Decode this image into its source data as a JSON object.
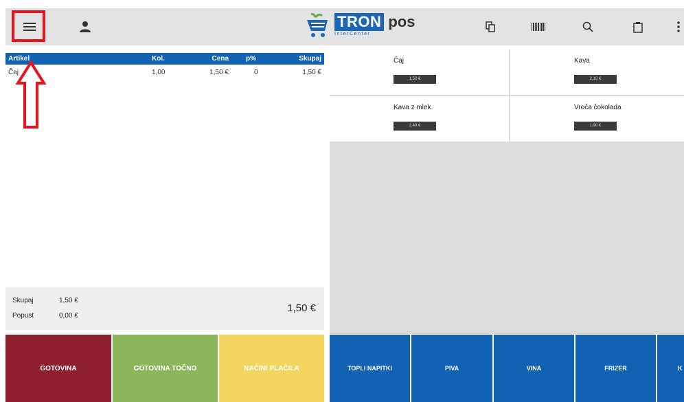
{
  "header": {
    "logo_brand": "TRON",
    "logo_sub": "InterCenter",
    "logo_suffix": "pos",
    "icons": [
      "menu-icon",
      "user-icon",
      "copy-icon",
      "barcode-icon",
      "search-icon",
      "clipboard-icon",
      "more-vert-icon"
    ]
  },
  "order": {
    "columns": {
      "item": "Artikel",
      "qty": "Kol.",
      "price": "Cena",
      "discount": "p%",
      "total": "Skupaj"
    },
    "rows": [
      {
        "item": "Čaj",
        "qty": "1,00",
        "price": "1,50 €",
        "discount": "0",
        "total": "1,50 €"
      }
    ]
  },
  "totals": {
    "subtotal_label": "Skupaj",
    "subtotal_value": "1,50 €",
    "discount_label": "Popust",
    "discount_value": "0,00 €",
    "grand_total": "1,50 €"
  },
  "payments": {
    "cash": "GOTOVINA",
    "exact_cash": "GOTOVINA TOČNO",
    "methods": "NAČINI PLAČILA"
  },
  "products": [
    {
      "name": "Čaj",
      "price": "1,50 €"
    },
    {
      "name": "Kava",
      "price": "2,10 €"
    },
    {
      "name": "Kava z mlek.",
      "price": "2,40 €"
    },
    {
      "name": "Vroča čokolada",
      "price": "1,90 €"
    }
  ],
  "categories": [
    "TOPLI NAPITKI",
    "PIVA",
    "VINA",
    "FRIZER",
    "K"
  ],
  "colors": {
    "accent_blue": "#1262b3",
    "cash": "#8d1f2e",
    "exact_cash": "#8db55b",
    "methods": "#f3d560",
    "highlight": "#e8141c"
  }
}
